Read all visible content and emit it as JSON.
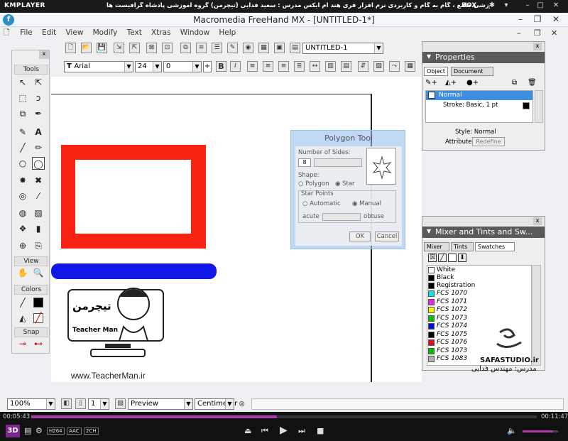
{
  "player": {
    "logo": "KMPLAYER",
    "caption": "مجموعه آموزشی جامع ، گام به گام و کاربردی نرم افزار فری هند ام ایکس  مدرس : سعید فدایی (تیچرمن) گروه آموزشی پادشاه گرافیست ها",
    "box_label": "BOX",
    "elapsed": "00:05:43",
    "total": "00:11:47",
    "progress": 0.486,
    "badges": [
      "H264",
      "AAC",
      "2CH"
    ],
    "volume": 0.85
  },
  "app": {
    "title": "Macromedia FreeHand MX - [UNTITLED-1*]",
    "menu": [
      "File",
      "Edit",
      "View",
      "Modify",
      "Text",
      "Xtras",
      "Window",
      "Help"
    ],
    "doc_select": "UNTITLED-1",
    "font_name": "Arial",
    "font_size": "24",
    "leading": "0",
    "style_b": "B"
  },
  "tools": {
    "header": "Tools",
    "view_header": "View",
    "colors_header": "Colors",
    "snap_header": "Snap"
  },
  "polygon_dialog": {
    "title": "Polygon Tool",
    "sides_label": "Number of Sides:",
    "sides_value": "8",
    "shape_label": "Shape:",
    "opt_polygon": "Polygon",
    "opt_star": "Star",
    "star_points_label": "Star Points",
    "opt_automatic": "Automatic",
    "opt_manual": "Manual",
    "acute_label": "acute",
    "obtuse_label": "obtuse",
    "ok": "OK",
    "cancel": "Cancel"
  },
  "properties": {
    "title": "Properties",
    "tab_object": "Object",
    "tab_document": "Document",
    "item_normal": "Normal",
    "item_stroke": "Stroke: Basic, 1 pt",
    "style_label": "Style: Normal",
    "attributes_label": "Attributes:",
    "redefine_button": "Redefine"
  },
  "mixer": {
    "title": "Mixer and Tints and Sw...",
    "tab_mixer": "Mixer",
    "tab_tints": "Tints",
    "tab_swatches": "Swatches",
    "swatches": [
      {
        "name": "White",
        "color": "#ffffff",
        "italic": false
      },
      {
        "name": "Black",
        "color": "#000000",
        "italic": false
      },
      {
        "name": "Registration",
        "color": "#000000",
        "italic": false
      },
      {
        "name": "FCS 1070",
        "color": "#00e5f0",
        "italic": true
      },
      {
        "name": "FCS 1071",
        "color": "#f020e0",
        "italic": true
      },
      {
        "name": "FCS 1072",
        "color": "#f5f500",
        "italic": true
      },
      {
        "name": "FCS 1073",
        "color": "#00c000",
        "italic": true
      },
      {
        "name": "FCS 1074",
        "color": "#0010e0",
        "italic": true
      },
      {
        "name": "FCS 1075",
        "color": "#000000",
        "italic": true
      },
      {
        "name": "FCS 1076",
        "color": "#e01010",
        "italic": true
      },
      {
        "name": "FCS 1073",
        "color": "#00c000",
        "italic": true
      },
      {
        "name": "FCS 1083",
        "color": "#b0b0b0",
        "italic": true
      }
    ]
  },
  "watermarks": {
    "teacherman_logo": "تیچرمن",
    "teacherman_name": "Teacher Man",
    "teacherman_url": "www.TeacherMan.ir",
    "safa": "SAFASTUDIO.ir",
    "instructor": "مدرس: مهندس فدایی"
  },
  "statusbar": {
    "zoom": "100%",
    "page": "1",
    "preview": "Preview",
    "units": "Centimeter"
  }
}
